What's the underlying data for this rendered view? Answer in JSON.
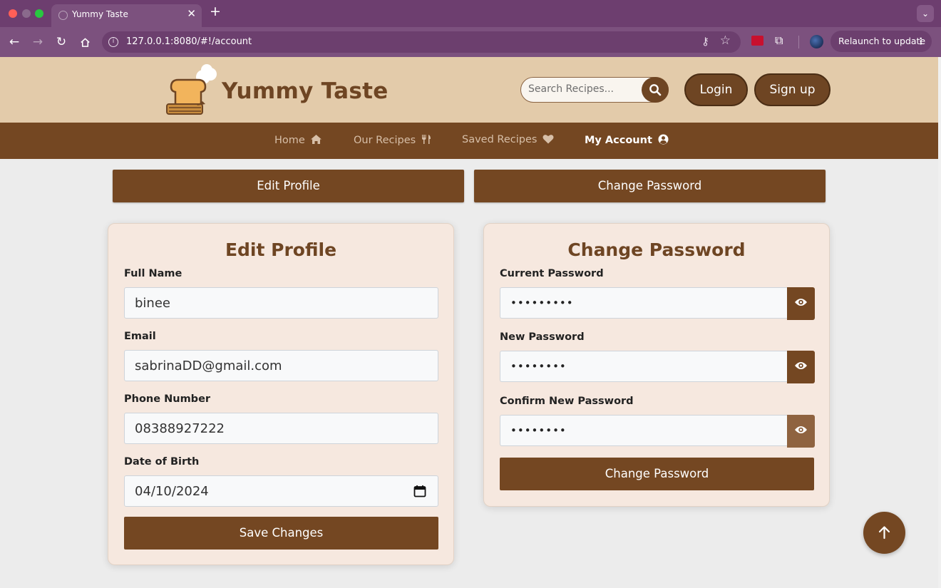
{
  "browser": {
    "tab_title": "Yummy Taste",
    "tab_close": "✕",
    "new_tab": "+",
    "url": "127.0.0.1:8080/#!/account",
    "relaunch_label": "Relaunch to update"
  },
  "site": {
    "brand": "Yummy Taste",
    "search_placeholder": "Search Recipes...",
    "login_label": "Login",
    "signup_label": "Sign up"
  },
  "nav": {
    "home": "Home",
    "recipes": "Our Recipes",
    "saved": "Saved Recipes",
    "account": "My Account"
  },
  "toggles": {
    "edit_profile": "Edit Profile",
    "change_password": "Change Password"
  },
  "profile": {
    "title": "Edit Profile",
    "full_name_label": "Full Name",
    "full_name": "binee",
    "email_label": "Email",
    "email": "sabrinaDD@gmail.com",
    "phone_label": "Phone Number",
    "phone": "08388927222",
    "dob_label": "Date of Birth",
    "dob": "04/10/2024",
    "save_label": "Save Changes"
  },
  "password": {
    "title": "Change Password",
    "current_label": "Current Password",
    "current_mask": "•••••••••",
    "new_label": "New Password",
    "new_mask": "••••••••",
    "confirm_label": "Confirm New Password",
    "confirm_mask": "••••••••",
    "submit_label": "Change Password"
  },
  "colors": {
    "brand_brown": "#744722",
    "header_beige": "#e3cbaa",
    "card_bg": "#f6e8df",
    "browser_purple": "#7c517e"
  }
}
